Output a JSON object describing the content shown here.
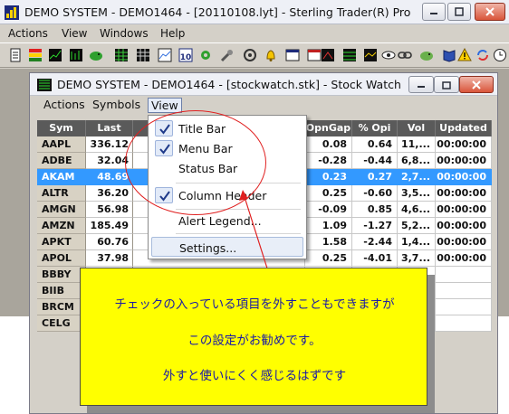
{
  "app": {
    "title": "DEMO SYSTEM - DEMO1464 - [20110108.lyt] - Sterling Trader(R) Pro",
    "menu": [
      "Actions",
      "View",
      "Windows",
      "Help"
    ],
    "toolbar_icons": [
      "document-icon",
      "color-bars-icon",
      "chart-icon",
      "chart-icon",
      "piggy-bank-icon",
      "grid-icon",
      "grid-icon",
      "chart-icon",
      "calendar-10-icon",
      "gear-icon",
      "tool-icon",
      "gear-icon",
      "bell-icon",
      "window-icon",
      "window-icon",
      "chart-icon",
      "grid-icon",
      "chart-icon",
      "eye-icon",
      "link-icon",
      "piggy-bank-icon",
      "book-icon",
      "warning-icon",
      "sync-icon",
      "clock-icon"
    ]
  },
  "stock_watch": {
    "title": "DEMO SYSTEM - DEMO1464 - [stockwatch.stk]  - Stock Watch",
    "menu": [
      "Actions",
      "Symbols",
      "View"
    ],
    "columns": [
      "Sym",
      "Last",
      "OpnGap",
      "% Opi",
      "Vol",
      "Updated"
    ],
    "rows": [
      {
        "sym": "AAPL",
        "last": "336.12",
        "opngap": "0.08",
        "pct": "0.64",
        "vol": "11,...",
        "updated": "00:00:00"
      },
      {
        "sym": "ADBE",
        "last": "32.04",
        "opngap": "-0.28",
        "pct": "-0.44",
        "vol": "6,8...",
        "updated": "00:00:00"
      },
      {
        "sym": "AKAM",
        "last": "48.69",
        "opngap": "0.23",
        "pct": "0.27",
        "vol": "2,7...",
        "updated": "00:00:00"
      },
      {
        "sym": "ALTR",
        "last": "36.20",
        "opngap": "0.25",
        "pct": "-0.60",
        "vol": "3,5...",
        "updated": "00:00:00"
      },
      {
        "sym": "AMGN",
        "last": "56.98",
        "opngap": "-0.09",
        "pct": "0.85",
        "vol": "4,6...",
        "updated": "00:00:00"
      },
      {
        "sym": "AMZN",
        "last": "185.49",
        "opngap": "1.09",
        "pct": "-1.27",
        "vol": "5,2...",
        "updated": "00:00:00"
      },
      {
        "sym": "APKT",
        "last": "60.76",
        "opngap": "1.58",
        "pct": "-2.44",
        "vol": "1,4...",
        "updated": "00:00:00"
      },
      {
        "sym": "APOL",
        "last": "37.98",
        "opngap": "0.25",
        "pct": "-4.01",
        "vol": "3,7...",
        "updated": "00:00:00"
      },
      {
        "sym": "BBBY",
        "last": "",
        "opngap": "",
        "pct": "",
        "vol": "",
        "updated": ""
      },
      {
        "sym": "BIIB",
        "last": "",
        "opngap": "",
        "pct": "",
        "vol": "",
        "updated": ""
      },
      {
        "sym": "BRCM",
        "last": "",
        "opngap": "",
        "pct": "",
        "vol": "",
        "updated": ""
      },
      {
        "sym": "CELG",
        "last": "",
        "opngap": "",
        "pct": "",
        "vol": "",
        "updated": ""
      }
    ],
    "selected_row": 2
  },
  "view_menu": {
    "items": [
      {
        "label": "Title Bar",
        "checked": true
      },
      {
        "label": "Menu Bar",
        "checked": true
      },
      {
        "label": "Status Bar",
        "checked": false
      },
      {
        "label": "Column Header",
        "checked": true
      },
      {
        "label": "Alert Legend...",
        "checked": false
      },
      {
        "label": "Settings...",
        "checked": false
      }
    ]
  },
  "callout": {
    "lines": [
      "チェックの入っている項目を外すこともできますが",
      "この設定がお勧めです。",
      "外すと使いにくく感じるはずです"
    ]
  },
  "colors": {
    "selection": "#3399ff",
    "callout_bg": "#ffff00",
    "callout_text": "#1a1aa6",
    "annotation": "#e02020"
  }
}
